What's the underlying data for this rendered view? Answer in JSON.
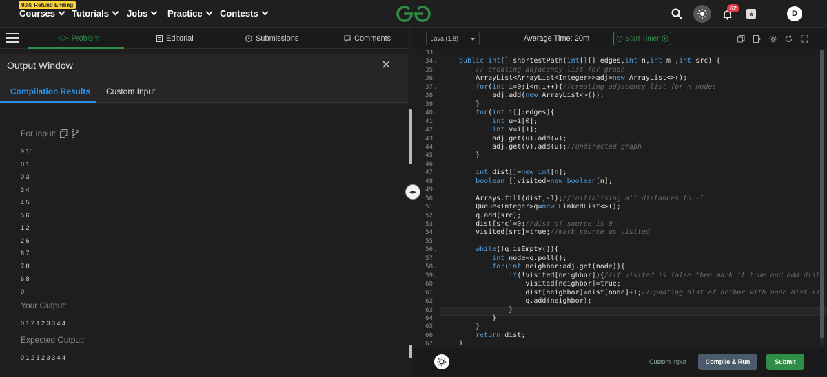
{
  "nav": {
    "refund_badge": "90% Refund Ending",
    "items": [
      "Courses",
      "Tutorials",
      "Jobs",
      "Practice",
      "Contests"
    ],
    "notification_count": "62",
    "avatar_letter": "D"
  },
  "problem_tabs": [
    "Problem",
    "Editorial",
    "Submissions",
    "Comments"
  ],
  "output": {
    "title": "Output Window",
    "tabs": [
      "Compilation Results",
      "Custom Input"
    ],
    "for_input_label": "For Input:",
    "input_lines": [
      "9 10",
      "0 1",
      "0 3",
      "3 4",
      "4 5",
      "5 6",
      "1 2",
      "2 6",
      "6 7",
      "7 8",
      "6 8",
      "0"
    ],
    "your_output_label": "Your Output:",
    "your_output": "0 1 2 1 2 3 3 4 4",
    "expected_output_label": "Expected Output:",
    "expected_output": "0 1 2 1 2 3 3 4 4"
  },
  "editor": {
    "language": "Java (1.8)",
    "average_time": "Average Time: 20m",
    "timer_label": "Start Timer",
    "line_numbers": [
      "33",
      "34",
      "35",
      "36",
      "37",
      "38",
      "39",
      "40",
      "41",
      "42",
      "43",
      "44",
      "45",
      "46",
      "47",
      "48",
      "49",
      "50",
      "51",
      "52",
      "53",
      "54",
      "55",
      "56",
      "57",
      "58",
      "59",
      "60",
      "61",
      "62",
      "63",
      "64",
      "65",
      "66",
      "67"
    ],
    "code_lines": [
      "",
      "public int[] shortestPath(int[][] edges,int n,int m ,int src) {",
      "    // creating adjacency list for graph",
      "    ArrayList<ArrayList<Integer>>adj=new ArrayList<>();",
      "    for(int i=0;i<n;i++){//creating adjacency list for n nodes",
      "        adj.add(new ArrayList<>());",
      "    }",
      "    for(int i[]:edges){",
      "        int u=i[0];",
      "        int v=i[1];",
      "        adj.get(u).add(v);",
      "        adj.get(v).add(u);//undirected graph",
      "    }",
      "",
      "    int dist[]=new int[n];",
      "    boolean []visited=new boolean[n];",
      "",
      "    Arrays.fill(dist,-1);//initialising all distances to -1",
      "    Queue<Integer>q=new LinkedList<>();",
      "    q.add(src);",
      "    dist[src]=0;//dist of source is 0",
      "    visited[src]=true;//mark source as visited",
      "",
      "    while(!q.isEmpty()){",
      "        int node=q.poll();",
      "        for(int neighbor:adj.get(node)){",
      "            if(!visited[neighbor]){//if visited is false then mark it true and add dist",
      "                visited[neighbor]=true;",
      "                dist[neighbor]=dist[node]+1;//updating dist of neibor with node dist +1",
      "                q.add(neighbor);",
      "            }",
      "        }",
      "    }",
      "    return dist;",
      "}"
    ],
    "custom_input_link": "Custom Input",
    "compile_label": "Compile & Run",
    "submit_label": "Submit"
  },
  "colors": {
    "brand_green": "#2f8d46",
    "accent_blue": "#2b8fe4",
    "keyword": "#569cd6",
    "comment": "#6a6a6a",
    "number": "#b5cea8"
  }
}
